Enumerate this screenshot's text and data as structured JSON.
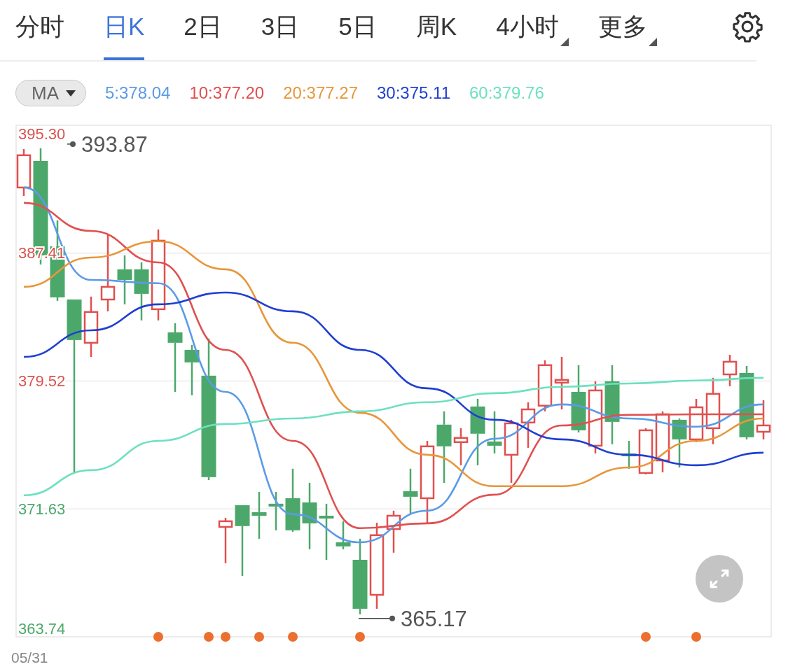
{
  "tabs": [
    {
      "label": "分时",
      "selected": false,
      "has_menu": false
    },
    {
      "label": "日K",
      "selected": true,
      "has_menu": false
    },
    {
      "label": "2日",
      "selected": false,
      "has_menu": false
    },
    {
      "label": "3日",
      "selected": false,
      "has_menu": false
    },
    {
      "label": "5日",
      "selected": false,
      "has_menu": false
    },
    {
      "label": "周K",
      "selected": false,
      "has_menu": false
    },
    {
      "label": "4小时",
      "selected": false,
      "has_menu": true
    },
    {
      "label": "更多",
      "selected": false,
      "has_menu": true
    }
  ],
  "indicator_selector": {
    "label": "MA"
  },
  "chart": {
    "chart_data": {
      "type": "line",
      "grid": true,
      "ylim": [
        363.74,
        395.3
      ],
      "yticks": [
        {
          "value": 395.3,
          "label": "395.30"
        },
        {
          "value": 387.41,
          "label": "387.41"
        },
        {
          "value": 379.52,
          "label": "379.52"
        },
        {
          "value": 371.63,
          "label": "371.63"
        },
        {
          "value": 363.74,
          "label": "363.74"
        }
      ],
      "series": [
        {
          "name": "5:378.04",
          "color": "#5b9be6",
          "values": [
            391.46,
            385.76,
            385.55,
            378.85,
            371.3,
            369.57,
            371.52,
            375.96,
            378.08,
            377.21,
            376.7,
            378.08
          ]
        },
        {
          "name": "10:377.20",
          "color": "#e0504f",
          "values": [
            390.51,
            388.78,
            386.84,
            381.44,
            375.83,
            370.44,
            370.74,
            372.51,
            376.78,
            377.43,
            377.47,
            377.47
          ]
        },
        {
          "name": "20:377.27",
          "color": "#e8963a",
          "values": [
            385.33,
            387.14,
            388.14,
            386.41,
            381.88,
            377.56,
            374.97,
            373.03,
            373.03,
            374.19,
            375.83,
            377.21
          ]
        },
        {
          "name": "30:375.11",
          "color": "#1f3fd1",
          "values": [
            381.01,
            382.65,
            384.25,
            384.98,
            383.82,
            381.44,
            379.07,
            377.13,
            375.92,
            374.97,
            374.32,
            375.1
          ]
        },
        {
          "name": "60:379.76",
          "color": "#6ee0c0",
          "values": [
            372.47,
            374.02,
            375.83,
            376.87,
            377.21,
            377.65,
            378.21,
            378.77,
            379.16,
            379.37,
            379.55,
            379.72
          ]
        }
      ],
      "annotations": [
        {
          "text": "393.87"
        },
        {
          "text": "365.17"
        }
      ]
    }
  },
  "date_label": "05/31"
}
